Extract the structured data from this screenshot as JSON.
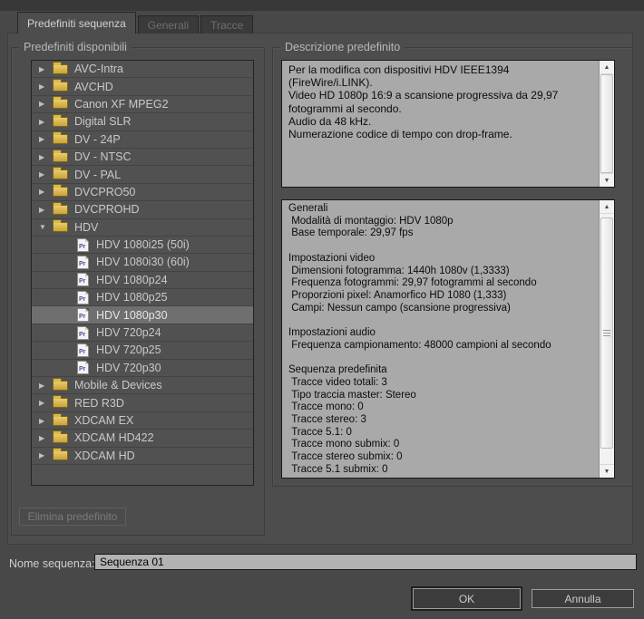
{
  "tabs": [
    {
      "label": "Predefiniti sequenza",
      "active": true
    },
    {
      "label": "Generali",
      "active": false
    },
    {
      "label": "Tracce",
      "active": false
    }
  ],
  "left_panel": {
    "group_title": "Predefiniti disponibili",
    "tree": [
      {
        "type": "folder",
        "label": "AVC-Intra",
        "expanded": false
      },
      {
        "type": "folder",
        "label": "AVCHD",
        "expanded": false
      },
      {
        "type": "folder",
        "label": "Canon XF MPEG2",
        "expanded": false
      },
      {
        "type": "folder",
        "label": "Digital SLR",
        "expanded": false
      },
      {
        "type": "folder",
        "label": "DV - 24P",
        "expanded": false
      },
      {
        "type": "folder",
        "label": "DV - NTSC",
        "expanded": false
      },
      {
        "type": "folder",
        "label": "DV - PAL",
        "expanded": false
      },
      {
        "type": "folder",
        "label": "DVCPRO50",
        "expanded": false
      },
      {
        "type": "folder",
        "label": "DVCPROHD",
        "expanded": false
      },
      {
        "type": "folder",
        "label": "HDV",
        "expanded": true
      },
      {
        "type": "preset",
        "label": "HDV 1080i25 (50i)"
      },
      {
        "type": "preset",
        "label": "HDV 1080i30 (60i)"
      },
      {
        "type": "preset",
        "label": "HDV 1080p24"
      },
      {
        "type": "preset",
        "label": "HDV 1080p25"
      },
      {
        "type": "preset",
        "label": "HDV 1080p30",
        "selected": true
      },
      {
        "type": "preset",
        "label": "HDV 720p24"
      },
      {
        "type": "preset",
        "label": "HDV 720p25"
      },
      {
        "type": "preset",
        "label": "HDV 720p30"
      },
      {
        "type": "folder",
        "label": "Mobile & Devices",
        "expanded": false
      },
      {
        "type": "folder",
        "label": "RED R3D",
        "expanded": false
      },
      {
        "type": "folder",
        "label": "XDCAM EX",
        "expanded": false
      },
      {
        "type": "folder",
        "label": "XDCAM HD422",
        "expanded": false
      },
      {
        "type": "folder",
        "label": "XDCAM HD",
        "expanded": false
      }
    ],
    "delete_button_label": "Elimina predefinito"
  },
  "right_panel": {
    "group_title": "Descrizione predefinito",
    "description_lines": [
      "Per la modifica con dispositivi HDV IEEE1394 (FireWire/i.LINK).",
      "Video HD 1080p 16:9 a scansione progressiva da 29,97 fotogrammi al secondo.",
      "Audio da 48 kHz.",
      "Numerazione codice di tempo con drop-frame."
    ],
    "details_lines": [
      "Generali",
      " Modalità di montaggio: HDV 1080p",
      " Base temporale: 29,97 fps",
      "",
      "Impostazioni video",
      " Dimensioni fotogramma: 1440h 1080v (1,3333)",
      " Frequenza fotogrammi: 29,97 fotogrammi al secondo",
      " Proporzioni pixel: Anamorfico HD 1080 (1,333)",
      " Campi: Nessun campo (scansione progressiva)",
      "",
      "Impostazioni audio",
      " Frequenza campionamento: 48000 campioni al secondo",
      "",
      "Sequenza predefinita",
      " Tracce video totali: 3",
      " Tipo traccia master: Stereo",
      " Tracce mono: 0",
      " Tracce stereo: 3",
      " Tracce 5.1: 0",
      " Tracce mono submix: 0",
      " Tracce stereo submix: 0",
      " Tracce 5.1 submix: 0"
    ]
  },
  "bottom": {
    "name_label": "Nome sequenza:",
    "name_value": "Sequenza 01",
    "ok_label": "OK",
    "cancel_label": "Annulla"
  },
  "icons": {
    "chevron_right": "▶",
    "chevron_down": "▼",
    "scroll_up": "▲",
    "scroll_down": "▼",
    "pr_label": "Pr"
  },
  "colors": {
    "dialog_bg": "#4d4d4d",
    "selection_bg": "#6f6f6f",
    "textbox_bg": "#a9a9a9",
    "folder_gold": "#d9b84f",
    "pr_purple": "#6b3fa0"
  }
}
